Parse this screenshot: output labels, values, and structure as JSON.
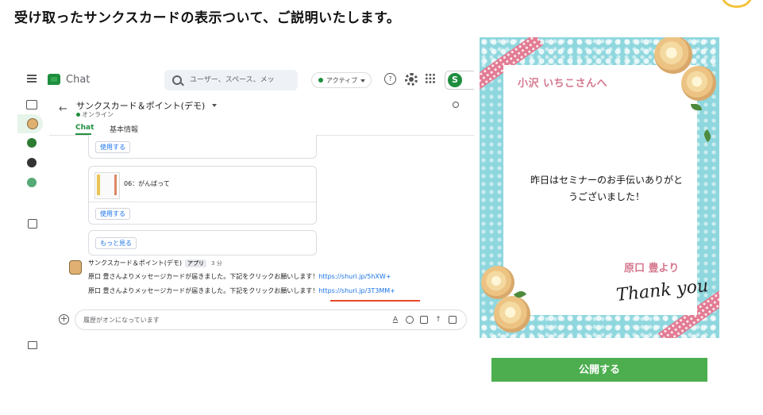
{
  "heading": "受け取ったサンクスカードの表示ついて、ご説明いたします。",
  "chat": {
    "app_name": "Chat",
    "search_placeholder": "ユーザー、スペース、メッ",
    "status": "アクティブ",
    "room": {
      "title": "サンクスカード＆ポイント(デモ)",
      "presence": "オンライン",
      "tabs": [
        "Chat",
        "基本情報"
      ]
    },
    "cards": [
      {
        "button": "使用する"
      },
      {
        "title": "06：がんばって",
        "button": "使用する"
      }
    ],
    "more_button": "もっと見る",
    "message": {
      "sender": "サンクスカード＆ポイント(デモ)",
      "badge": "アプリ",
      "time": "3 分",
      "lines": [
        {
          "text": "原口 豊さんよりメッセージカードが届きました。下記をクリックお願いします！",
          "link": "https://shuri.jp/5hXW+"
        },
        {
          "text": "原口 豊さんよりメッセージカードが届きました。下記をクリックお願いします！",
          "link": "https://shuri.jp/3T3MM+"
        }
      ]
    },
    "composer_placeholder": "履歴がオンになっています"
  },
  "card_preview": {
    "to": "小沢 いちこさんへ",
    "message_lines": [
      "昨日はセミナーのお手伝いありがと",
      "うございました！"
    ],
    "from": "原口 豊より",
    "signature": "Thank you"
  },
  "publish_button": "公開する",
  "colors": {
    "accent_green": "#4cae4f",
    "card_pink": "#d5788e",
    "card_teal": "#8fd7de",
    "underline_red": "#e8472b"
  }
}
